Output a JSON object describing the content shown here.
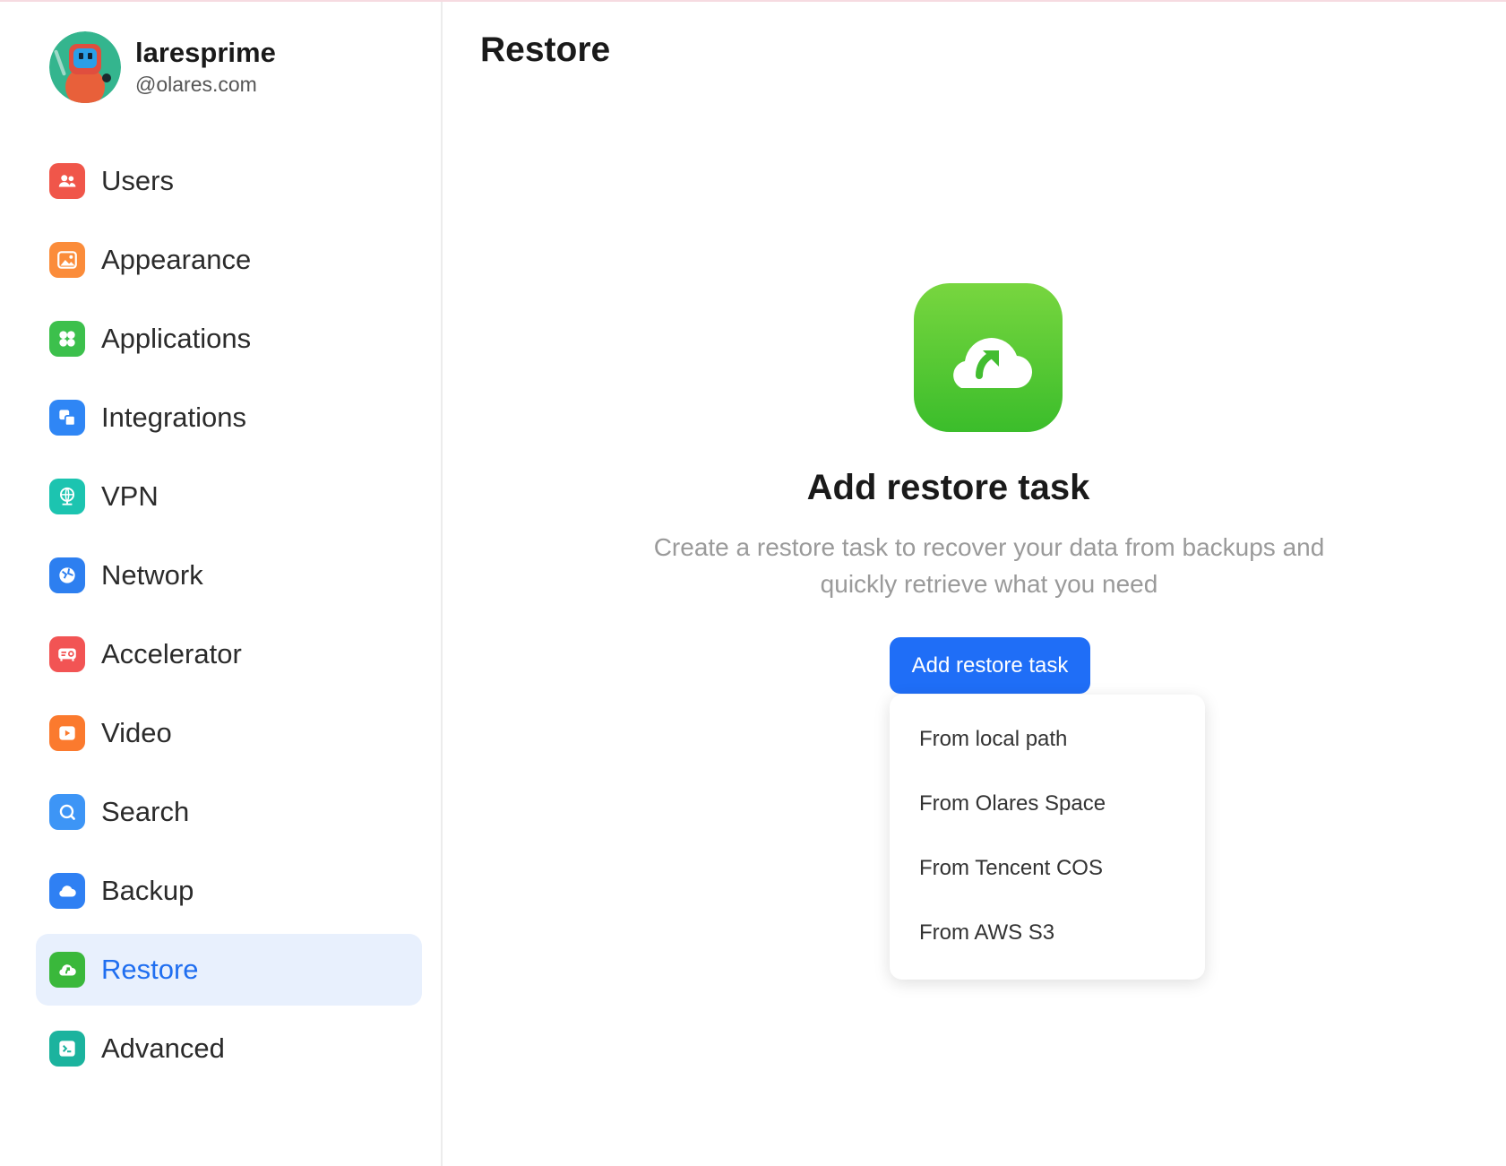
{
  "profile": {
    "username": "laresprime",
    "domain": "@olares.com"
  },
  "sidebar": {
    "items": [
      {
        "label": "Users",
        "icon": "users-icon",
        "color": "#f0564a"
      },
      {
        "label": "Appearance",
        "icon": "image-icon",
        "color": "#fb8c3a"
      },
      {
        "label": "Applications",
        "icon": "apps-icon",
        "color": "#3cc04c"
      },
      {
        "label": "Integrations",
        "icon": "integrations-icon",
        "color": "#2f86f5"
      },
      {
        "label": "VPN",
        "icon": "vpn-globe-icon",
        "color": "#1cc4b0"
      },
      {
        "label": "Network",
        "icon": "network-icon",
        "color": "#2d7ff0"
      },
      {
        "label": "Accelerator",
        "icon": "accelerator-icon",
        "color": "#f25454"
      },
      {
        "label": "Video",
        "icon": "video-play-icon",
        "color": "#fb7a2e"
      },
      {
        "label": "Search",
        "icon": "search-icon",
        "color": "#3d95f6"
      },
      {
        "label": "Backup",
        "icon": "cloud-icon",
        "color": "#2f80f3"
      },
      {
        "label": "Restore",
        "icon": "restore-cloud-icon",
        "color": "#3ab83b",
        "active": true
      },
      {
        "label": "Advanced",
        "icon": "terminal-icon",
        "color": "#1bb39e"
      }
    ]
  },
  "main": {
    "title": "Restore",
    "empty_title": "Add restore task",
    "empty_desc": "Create a restore task to recover your data from backups and quickly retrieve what you need",
    "add_button": "Add restore task",
    "accent": "#1f6ef7",
    "menu": [
      "From local path",
      "From Olares Space",
      "From Tencent COS",
      "From AWS S3"
    ]
  }
}
